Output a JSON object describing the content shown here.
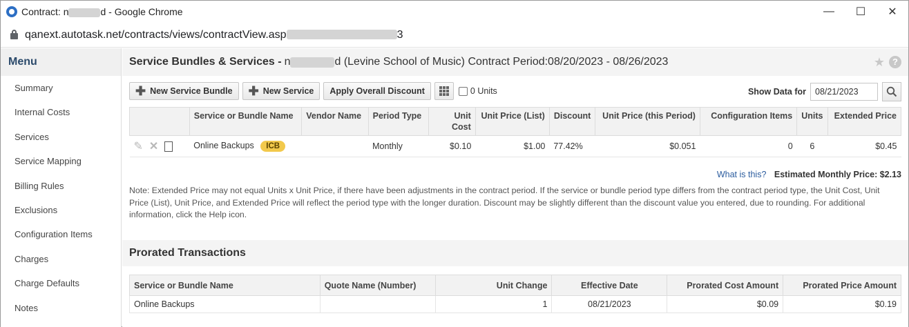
{
  "window": {
    "title_prefix": "Contract: n",
    "title_suffix": "d - Google Chrome",
    "url_visible": "qanext.autotask.net/contracts/views/contractView.asp",
    "url_tail": "3",
    "controls": {
      "minimize": "—",
      "maximize": "☐",
      "close": "✕"
    }
  },
  "sidebar": {
    "heading": "Menu",
    "items": [
      {
        "label": "Summary"
      },
      {
        "label": "Internal Costs"
      },
      {
        "label": "Services"
      },
      {
        "label": "Service Mapping"
      },
      {
        "label": "Billing Rules"
      },
      {
        "label": "Exclusions"
      },
      {
        "label": "Configuration Items"
      },
      {
        "label": "Charges"
      },
      {
        "label": "Charge Defaults"
      },
      {
        "label": "Notes"
      }
    ]
  },
  "header": {
    "title_bold": "Service Bundles & Services -",
    "title_name_prefix": "n",
    "title_rest": "d (Levine School of Music) Contract Period:08/20/2023 - 08/26/2023",
    "help_label": "?"
  },
  "toolbar": {
    "new_bundle_label": "New Service Bundle",
    "new_service_label": "New Service",
    "apply_discount_label": "Apply Overall Discount",
    "zero_units_label": "0 Units",
    "show_data_label": "Show Data for",
    "show_data_value": "08/21/2023"
  },
  "services_table": {
    "columns": {
      "name": "Service or Bundle Name",
      "vendor": "Vendor Name",
      "period": "Period Type",
      "unit_cost": "Unit Cost",
      "unit_price_list": "Unit Price (List)",
      "discount": "Discount",
      "unit_price_period": "Unit Price (this Period)",
      "config_items": "Configuration Items",
      "units": "Units",
      "extended": "Extended Price"
    },
    "rows": [
      {
        "name": "Online Backups",
        "badge": "ICB",
        "vendor": "",
        "period": "Monthly",
        "unit_cost": "$0.10",
        "unit_price_list": "$1.00",
        "discount": "77.42%",
        "unit_price_period": "$0.051",
        "config_items": "0",
        "units": "6",
        "extended": "$0.45"
      }
    ]
  },
  "estimate": {
    "what_is_this": "What is this?",
    "label": "Estimated Monthly Price:",
    "value": "$2.13"
  },
  "note": "Note: Extended Price may not equal Units x Unit Price, if there have been adjustments in the contract period. If the service or bundle period type differs from the contract period type, the Unit Cost, Unit Price (List), Unit Price, and Extended Price will reflect the period type with the longer duration. Discount may be slightly different than the discount value you entered, due to rounding. For additional information, click the Help icon.",
  "prorated": {
    "heading": "Prorated Transactions",
    "columns": {
      "name": "Service or Bundle Name",
      "quote": "Quote Name (Number)",
      "unit_change": "Unit Change",
      "effective": "Effective Date",
      "cost": "Prorated Cost Amount",
      "price": "Prorated Price Amount"
    },
    "rows": [
      {
        "name": "Online Backups",
        "quote": "",
        "unit_change": "1",
        "effective": "08/21/2023",
        "cost": "$0.09",
        "price": "$0.19"
      }
    ]
  }
}
